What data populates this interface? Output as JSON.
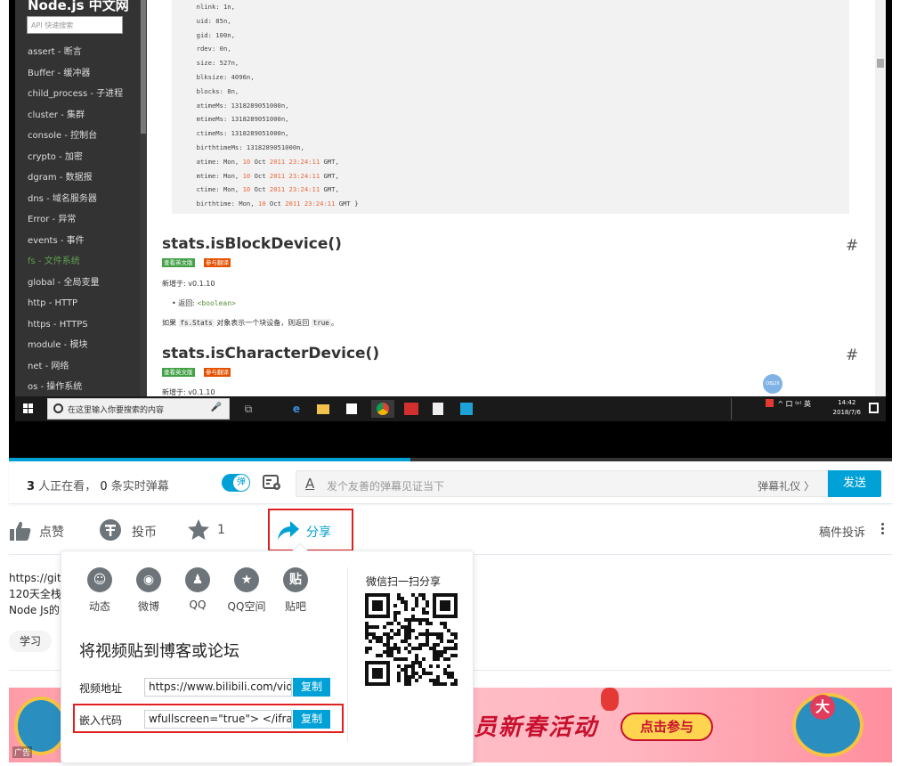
{
  "doc_site": {
    "logo": "Node.js 中文网",
    "search_placeholder": "API 快速搜索",
    "nav": [
      "assert - 断言",
      "Buffer - 缓冲器",
      "child_process - 子进程",
      "cluster - 集群",
      "console - 控制台",
      "crypto - 加密",
      "dgram - 数据报",
      "dns - 域名服务器",
      "Error - 异常",
      "events - 事件",
      "fs - 文件系统",
      "global - 全局变量",
      "http - HTTP",
      "https - HTTPS",
      "module - 模块",
      "net - 网络",
      "os - 操作系统"
    ],
    "active_nav_index": 10,
    "code_lines": [
      "  nlink: 1n,",
      "  uid: 85n,",
      "  gid: 100n,",
      "  rdev: 0n,",
      "  size: 527n,",
      "  blksize: 4096n,",
      "  blocks: 8n,",
      "  atimeMs: 1318289051000n,",
      "  mtimeMs: 1318289051000n,",
      "  ctimeMs: 1318289051000n,",
      "  birthtimeMs: 1318289051000n,",
      "  atime: Mon, 10 Oct 2011 23:24:11 GMT,",
      "  mtime: Mon, 10 Oct 2011 23:24:11 GMT,",
      "  ctime: Mon, 10 Oct 2011 23:24:11 GMT,",
      "  birthtime: Mon, 10 Oct 2011 23:24:11 GMT }"
    ],
    "section1": {
      "heading": "stats.isBlockDevice()",
      "hash": "#",
      "tag_en": "查看英文版",
      "tag_translate": "参与翻译",
      "added": "新增于: v0.1.10",
      "returns_label": "返回: ",
      "returns_type": "<boolean>",
      "desc_prefix": "如果 ",
      "desc_code1": "fs.Stats",
      "desc_mid": " 对象表示一个块设备，则返回 ",
      "desc_code2": "true",
      "desc_suffix": "。"
    },
    "section2": {
      "heading": "stats.isCharacterDevice()",
      "hash": "#",
      "tag_en": "查看英文版",
      "tag_translate": "参与翻译",
      "added": "新增于: v0.1.10"
    },
    "float_btn": "OBJ2X"
  },
  "taskbar": {
    "search_placeholder": "在这里输入你要搜索的内容",
    "tray_text": "^ 口 ⁽ᵖ⁾ 英",
    "time": "14:42",
    "date": "2018/7/6"
  },
  "player": {
    "progress_fraction": 0.455
  },
  "danmaku": {
    "viewer_count": "3",
    "viewer_text_1": " 人正在看， ",
    "danmaku_count": "0",
    "viewer_text_2": " 条实时弹幕",
    "toggle_label": "弹",
    "input_icon": "A",
    "placeholder": "发个友善的弹幕见证当下",
    "etiquette": "弹幕礼仪 〉",
    "send": "发送"
  },
  "actions": {
    "like": "点赞",
    "coin": "投币",
    "favorite_count": "1",
    "share": "分享",
    "report": "稿件投诉"
  },
  "description": {
    "lines": [
      "https://githu",
      "120天全栈|",
      "Node Js的"
    ],
    "tag": "学习"
  },
  "banner": {
    "title": "员新春活动",
    "button": "点击参与",
    "badge": "大",
    "ad_label": "广告"
  },
  "share_popup": {
    "targets": [
      {
        "label": "动态",
        "icon": "dynamic-icon",
        "glyph": "☺"
      },
      {
        "label": "微博",
        "icon": "weibo-icon",
        "glyph": "◉"
      },
      {
        "label": "QQ",
        "icon": "qq-icon",
        "glyph": "♟"
      },
      {
        "label": "QQ空间",
        "icon": "qzone-icon",
        "glyph": "★"
      },
      {
        "label": "贴吧",
        "icon": "tieba-icon",
        "glyph": "贴"
      }
    ],
    "embed_title": "将视频贴到博客或论坛",
    "video_url_label": "视频地址",
    "video_url_value": "https://www.bilibili.com/video/av",
    "embed_code_label": "嵌入代码",
    "embed_code_value": "wfullscreen=\"true\"> </iframe>",
    "copy": "复制",
    "wechat_label": "微信扫一扫分享"
  },
  "colors": {
    "accent": "#00a1d6",
    "highlight": "#e02020",
    "doc_sidebar": "#333333",
    "node_green": "#5fa04e"
  }
}
